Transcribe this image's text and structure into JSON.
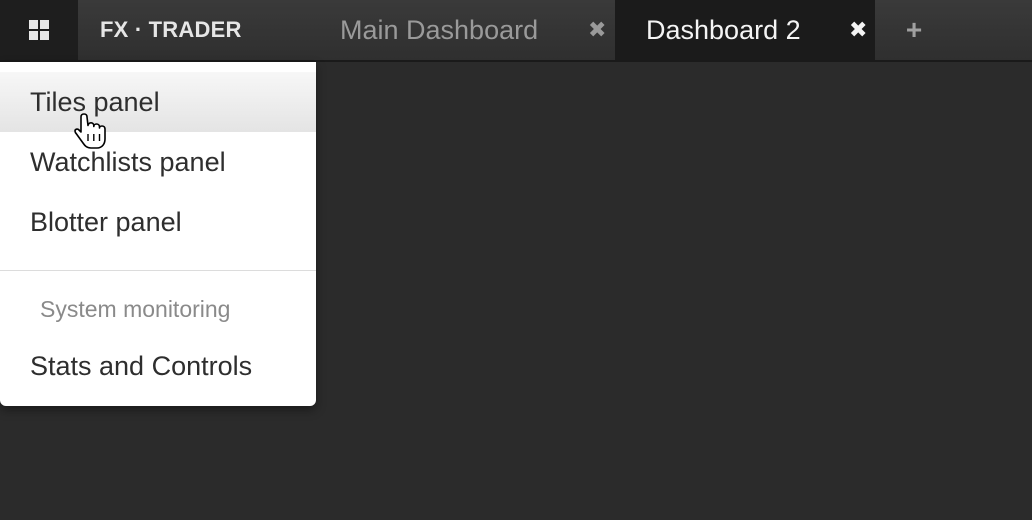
{
  "header": {
    "brand": "FX · TRADER",
    "tabs": [
      {
        "label": "Main Dashboard",
        "close": "✖",
        "active": false
      },
      {
        "label": "Dashboard 2",
        "close": "✖",
        "active": true
      }
    ],
    "add_tab": "+"
  },
  "menu": {
    "items": [
      {
        "label": "Tiles panel"
      },
      {
        "label": "Watchlists panel"
      },
      {
        "label": "Blotter panel"
      }
    ],
    "section_header": "System monitoring",
    "section_items": [
      {
        "label": "Stats and Controls"
      }
    ]
  },
  "colors": {
    "background": "#2b2b2b",
    "topbar": "#333333",
    "active_tab": "#1b1b1b",
    "menu_bg": "#ffffff",
    "menu_text": "#2e2e2e",
    "muted_text": "#8a8a8a"
  },
  "icons": {
    "apps": "grid-icon",
    "close": "close-icon",
    "add": "plus-icon",
    "cursor": "hand-pointer-icon"
  }
}
